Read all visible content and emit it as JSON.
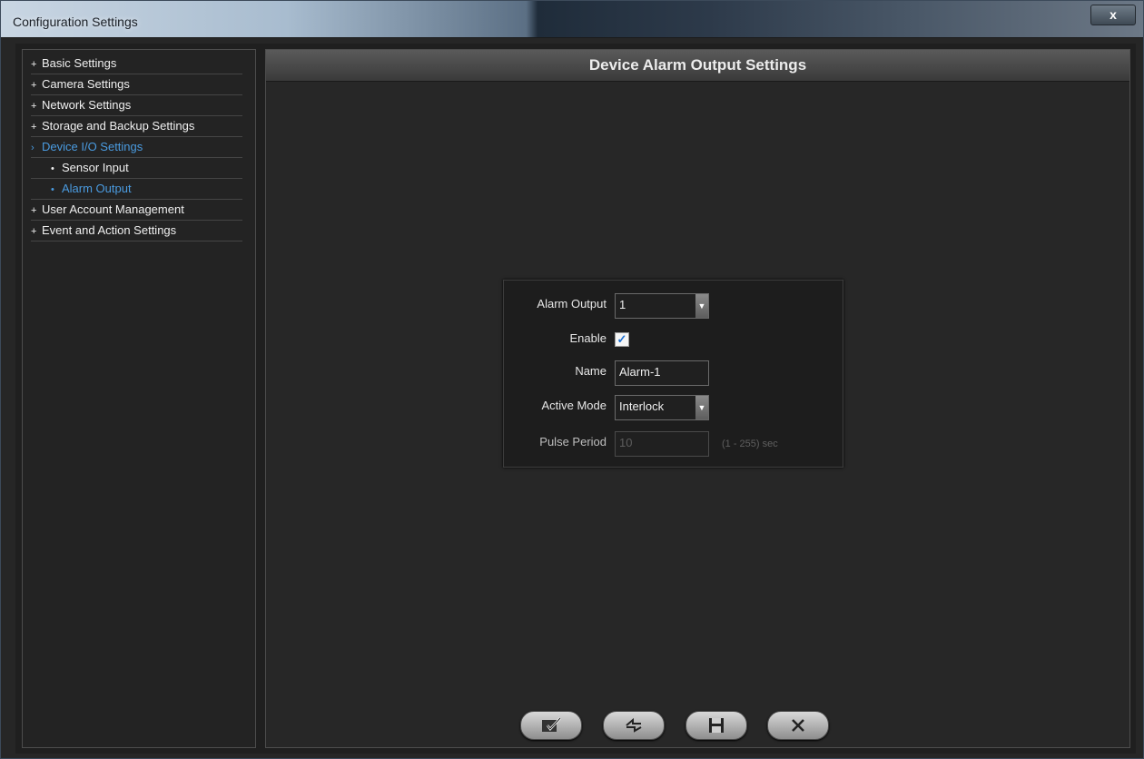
{
  "window": {
    "title": "Configuration Settings",
    "close_label": "x"
  },
  "sidebar": {
    "items": [
      {
        "bullet": "+",
        "label": "Basic Settings"
      },
      {
        "bullet": "+",
        "label": "Camera Settings"
      },
      {
        "bullet": "+",
        "label": "Network Settings"
      },
      {
        "bullet": "+",
        "label": "Storage and Backup Settings"
      },
      {
        "bullet": "›",
        "label": "Device I/O Settings"
      },
      {
        "bullet": "•",
        "label": "Sensor Input"
      },
      {
        "bullet": "•",
        "label": "Alarm Output"
      },
      {
        "bullet": "+",
        "label": "User Account Management"
      },
      {
        "bullet": "+",
        "label": "Event and Action Settings"
      }
    ]
  },
  "main": {
    "title": "Device Alarm Output Settings"
  },
  "form": {
    "alarm_output_label": "Alarm Output",
    "alarm_output_value": "1",
    "enable_label": "Enable",
    "enable_checked": true,
    "check_mark": "✓",
    "name_label": "Name",
    "name_value": "Alarm-1",
    "active_mode_label": "Active Mode",
    "active_mode_value": "Interlock",
    "pulse_period_label": "Pulse Period",
    "pulse_period_value": "10",
    "pulse_period_hint": "(1 - 255)  sec",
    "dropdown_arrow": "▼"
  },
  "footer": {
    "apply_icon": "check-icon",
    "refresh_icon": "refresh-icon",
    "save_icon": "save-icon",
    "cancel_icon": "close-icon"
  },
  "colors": {
    "accent": "#4a9be0",
    "background": "#262626",
    "panel": "#1d1d1d"
  }
}
